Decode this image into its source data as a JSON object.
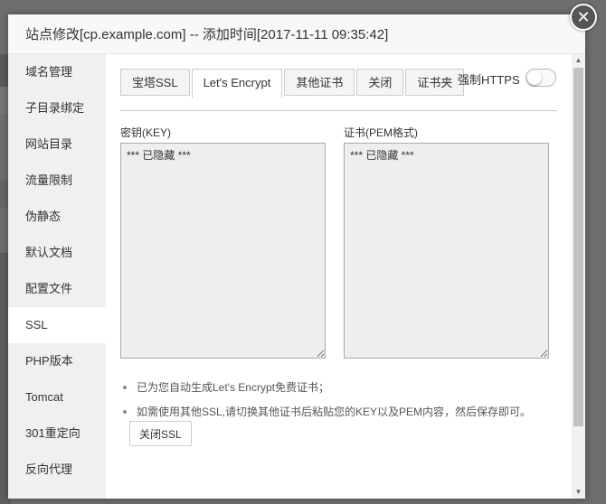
{
  "dialog": {
    "title": "站点修改[cp.example.com] -- 添加时间[2017-11-11 09:35:42]",
    "close_symbol": "✕"
  },
  "sidebar": {
    "items": [
      {
        "label": "域名管理",
        "icon": ""
      },
      {
        "label": "子目录绑定"
      },
      {
        "label": "网站目录"
      },
      {
        "label": "流量限制"
      },
      {
        "label": "伪静态"
      },
      {
        "label": "默认文档"
      },
      {
        "label": "配置文件"
      },
      {
        "label": "SSL"
      },
      {
        "label": "PHP版本"
      },
      {
        "label": "Tomcat"
      },
      {
        "label": "301重定向"
      },
      {
        "label": "反向代理"
      }
    ],
    "active_index": 7
  },
  "tabs": [
    {
      "label": "宝塔SSL"
    },
    {
      "label": "Let's Encrypt"
    },
    {
      "label": "其他证书"
    },
    {
      "label": "关闭"
    },
    {
      "label": "证书夹"
    }
  ],
  "active_tab_index": 1,
  "https": {
    "label": "强制HTTPS",
    "enabled": false
  },
  "key_field": {
    "label": "密钥(KEY)",
    "value": "*** 已隐藏 ***"
  },
  "cert_field": {
    "label": "证书(PEM格式)",
    "value": "*** 已隐藏 ***"
  },
  "notes": [
    "已为您自动生成Let's Encrypt免费证书；",
    "如需使用其他SSL,请切换其他证书后粘贴您的KEY以及PEM内容，然后保存即可。"
  ],
  "close_ssl_button": "关闭SSL",
  "colors": {
    "overlay": "#6e6e6e",
    "sidebar_bg": "#f0f0f0",
    "textarea_bg": "#eeeeee"
  }
}
